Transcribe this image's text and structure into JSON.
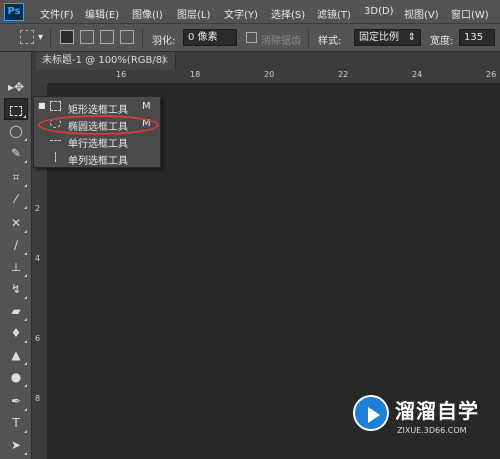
{
  "app": {
    "logo": "Ps"
  },
  "menu": [
    "文件(F)",
    "编辑(E)",
    "图像(I)",
    "图层(L)",
    "文字(Y)",
    "选择(S)",
    "滤镜(T)",
    "3D(D)",
    "视图(V)",
    "窗口(W)"
  ],
  "options": {
    "feather_label": "羽化:",
    "feather_value": "0 像素",
    "antialias_label": "消除锯齿",
    "style_label": "样式:",
    "style_value": "固定比例",
    "width_label": "宽度:",
    "width_value": "135"
  },
  "document": {
    "tab_title": "未标题-1 @ 100%(RGB/8)",
    "close": "×"
  },
  "rulers": {
    "horizontal": [
      "16",
      "18",
      "20",
      "22",
      "24",
      "26"
    ],
    "vertical": [
      "0",
      "2",
      "4",
      "6",
      "8",
      "0",
      "2",
      "4",
      "6",
      "8"
    ]
  },
  "flyout": {
    "items": [
      {
        "label": "矩形选框工具",
        "key": "M",
        "active": true
      },
      {
        "label": "椭圆选框工具",
        "key": "M",
        "active": false
      },
      {
        "label": "单行选框工具",
        "key": "",
        "active": false
      },
      {
        "label": "单列选框工具",
        "key": "",
        "active": false
      }
    ],
    "highlight_color": "#d93a3a"
  },
  "tools": [
    "move-icon",
    "marquee-icon",
    "lasso-icon",
    "quick-select-icon",
    "crop-icon",
    "eyedropper-icon",
    "healing-icon",
    "brush-icon",
    "stamp-icon",
    "history-brush-icon",
    "eraser-icon",
    "bucket-icon",
    "blur-icon",
    "dodge-icon",
    "pen-icon",
    "type-icon",
    "path-select-icon"
  ],
  "watermark": {
    "title": "溜溜自学",
    "url": "ZIXUE.3D66.COM"
  }
}
